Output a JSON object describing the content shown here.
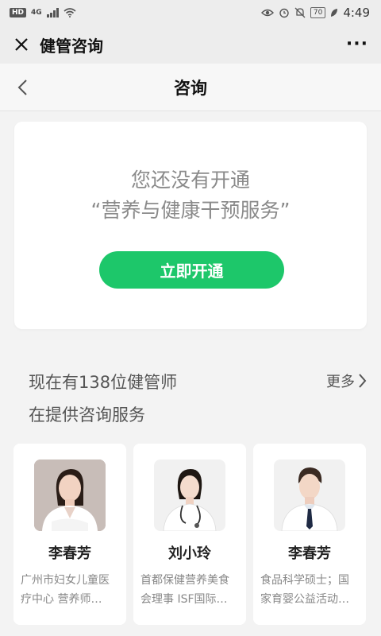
{
  "status_bar": {
    "hd": "HD",
    "network": "4G",
    "battery": "70",
    "time": "4:49"
  },
  "titlebar": {
    "title": "健管咨询",
    "more": "···",
    "close_icon": "close-icon",
    "more_icon": "more-dots-icon"
  },
  "nav": {
    "title": "咨询",
    "back_icon": "chevron-left-icon"
  },
  "promo": {
    "line1": "您还没有开通",
    "line2": "“营养与健康干预服务”",
    "button_label": "立即开通"
  },
  "section": {
    "title_line1": "现在有138位健管师",
    "title_line2": "在提供咨询服务",
    "more_label": "更多",
    "more_icon": "chevron-right-icon"
  },
  "doctors": [
    {
      "name": "李春芳",
      "desc": "广州市妇女儿童医疗中心 营养师…",
      "avatar_icon": "female-doctor-avatar"
    },
    {
      "name": "刘小玲",
      "desc": "首都保健营养美食会理事 ISF国际…",
      "avatar_icon": "female-doctor-stethoscope-avatar"
    },
    {
      "name": "李春芳",
      "desc": "食品科学硕士；国家育婴公益活动…",
      "avatar_icon": "male-doctor-avatar"
    }
  ],
  "colors": {
    "accent": "#1dc76a",
    "background": "#f3f3f3",
    "card": "#ffffff",
    "muted_text": "#8a8a8a"
  }
}
